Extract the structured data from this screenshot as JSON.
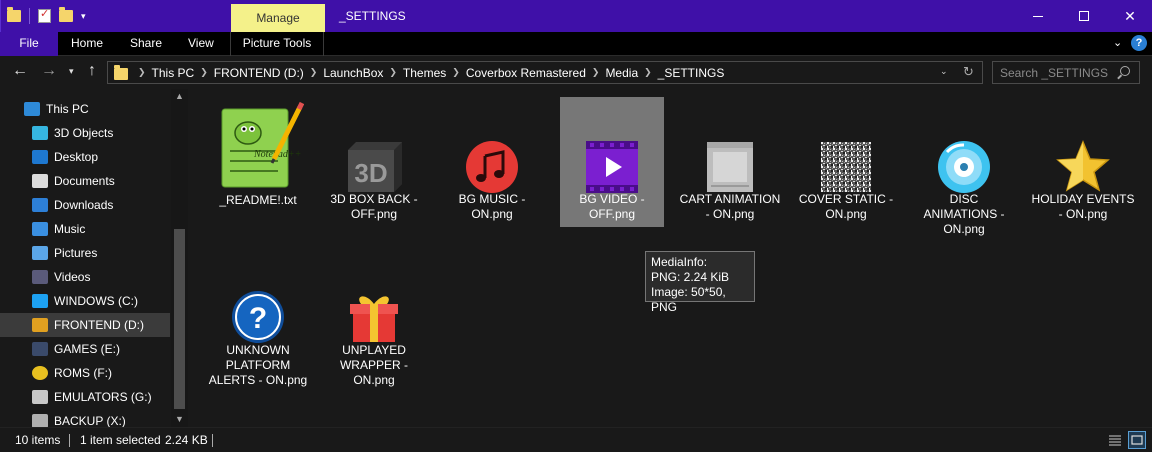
{
  "titlebar": {
    "manage_label": "Manage",
    "title": "_SETTINGS",
    "bg_color": "#3f10a8",
    "manage_color": "#f4f18a"
  },
  "ribbon": {
    "file": "File",
    "home": "Home",
    "share": "Share",
    "view": "View",
    "picture_tools": "Picture Tools",
    "help": "?"
  },
  "address": {
    "crumbs": [
      "This PC",
      "FRONTEND (D:)",
      "LaunchBox",
      "Themes",
      "Coverbox Remastered",
      "Media",
      "_SETTINGS"
    ],
    "search_placeholder": "Search _SETTINGS"
  },
  "nav": {
    "items": [
      {
        "label": "This PC",
        "icon": "monitor-icon"
      },
      {
        "label": "3D Objects",
        "icon": "cube-icon"
      },
      {
        "label": "Desktop",
        "icon": "desktop-icon"
      },
      {
        "label": "Documents",
        "icon": "document-icon"
      },
      {
        "label": "Downloads",
        "icon": "download-arrow-icon"
      },
      {
        "label": "Music",
        "icon": "music-note-icon"
      },
      {
        "label": "Pictures",
        "icon": "picture-icon"
      },
      {
        "label": "Videos",
        "icon": "film-icon"
      },
      {
        "label": "WINDOWS (C:)",
        "icon": "windows-drive-icon"
      },
      {
        "label": "FRONTEND (D:)",
        "icon": "launchbox-drive-icon"
      },
      {
        "label": "GAMES (E:)",
        "icon": "steam-drive-icon"
      },
      {
        "label": "ROMS (F:)",
        "icon": "pacman-drive-icon"
      },
      {
        "label": "EMULATORS (G:)",
        "icon": "controller-drive-icon"
      },
      {
        "label": "BACKUP (X:)",
        "icon": "drive-icon"
      }
    ]
  },
  "files": [
    {
      "label": "_README!.txt",
      "icon": "notepad-plus-plus-icon"
    },
    {
      "label": "3D BOX BACK - OFF.png",
      "icon": "3d-badge-icon"
    },
    {
      "label": "BG MUSIC - ON.png",
      "icon": "music-note-icon"
    },
    {
      "label": "BG VIDEO - OFF.png",
      "icon": "video-play-icon"
    },
    {
      "label": "CART ANIMATION - ON.png",
      "icon": "cartridge-icon"
    },
    {
      "label": "COVER STATIC - ON.png",
      "icon": "tv-static-icon"
    },
    {
      "label": "DISC ANIMATIONS - ON.png",
      "icon": "disc-icon"
    },
    {
      "label": "HOLIDAY EVENTS - ON.png",
      "icon": "star-icon"
    },
    {
      "label": "UNKNOWN PLATFORM ALERTS - ON.png",
      "icon": "question-icon"
    },
    {
      "label": "UNPLAYED WRAPPER - ON.png",
      "icon": "gift-icon"
    }
  ],
  "tooltip": {
    "line1": "MediaInfo:",
    "line2": "PNG: 2.24 KiB",
    "line3": "Image: 50*50, PNG"
  },
  "status": {
    "count": "10 items",
    "selected": "1 item selected",
    "size": "2.24 KB"
  }
}
